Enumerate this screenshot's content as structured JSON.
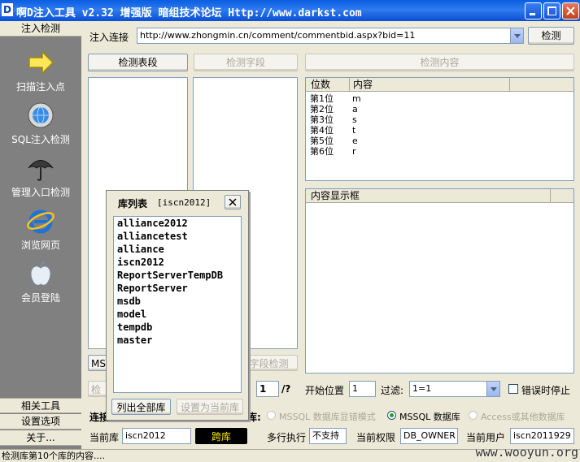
{
  "window": {
    "title": "啊D注入工具 v2.32 增强版 暗组技术论坛 Http://www.darkst.com",
    "icon_letter": "D"
  },
  "sidebar": {
    "top_tab": "注入检测",
    "items": [
      {
        "label": "扫描注入点",
        "icon": "arrow-right-icon"
      },
      {
        "label": "SQL注入检测",
        "icon": "globe-gear-icon"
      },
      {
        "label": "管理入口检测",
        "icon": "umbrella-icon"
      },
      {
        "label": "浏览网页",
        "icon": "ie-browser-icon"
      },
      {
        "label": "会员登陆",
        "icon": "apple-icon"
      }
    ],
    "bottom_tabs": [
      "相关工具",
      "设置选项",
      "关于..."
    ]
  },
  "toolbar": {
    "url_label": "注入连接",
    "url_value": "http://www.zhongmin.cn/comment/commentbid.aspx?bid=11",
    "detect_button": "检测"
  },
  "buttons": {
    "detect_tables": "检测表段",
    "detect_fields": "检测字段",
    "detect_content": "检测内容",
    "field_detect_secondary": "字段检测",
    "list_all": "列出全部库",
    "set_current": "设置为当前库",
    "switch_db": "跨库"
  },
  "content_grid": {
    "headers": [
      "位数",
      "内容"
    ],
    "rows": [
      [
        "第1位",
        "m"
      ],
      [
        "第2位",
        "a"
      ],
      [
        "第3位",
        "s"
      ],
      [
        "第4位",
        "t"
      ],
      [
        "第5位",
        "e"
      ],
      [
        "第6位",
        "r"
      ]
    ]
  },
  "content_display": {
    "header": "内容显示框"
  },
  "popup": {
    "title": "库列表",
    "subtitle": "[iscn2012]",
    "databases": [
      "alliance2012",
      "alliancetest",
      "alliance",
      "iscn2012",
      "ReportServerTempDB",
      "ReportServer",
      "msdb",
      "model",
      "tempdb",
      "master"
    ]
  },
  "params": {
    "count_value": "1",
    "count_suffix": "/?",
    "start_label": "开始位置",
    "start_value": "1",
    "filter_label": "过滤:",
    "filter_value": "1=1",
    "stop_on_error": "错误时停止",
    "hidden_left_btn": "检",
    "hidden_left_mode": "MS"
  },
  "connect": {
    "label_fragment": "连接",
    "type_label": "库:",
    "options": [
      {
        "label": "MSSQL 数据库显错模式",
        "selected": false
      },
      {
        "label": "MSSQL 数据库",
        "selected": true
      },
      {
        "label": "Access或其他数据库",
        "selected": false
      }
    ]
  },
  "info": {
    "current_db_label": "当前库",
    "current_db": "iscn2012",
    "multi_exec_label": "多行执行",
    "multi_exec": "不支持",
    "perm_label": "当前权限",
    "perm": "DB_OWNER",
    "user_label": "当前用户",
    "user": "iscn2011929"
  },
  "status": "检测库第10个库的内容....",
  "watermark": "www.wooyun.org"
}
